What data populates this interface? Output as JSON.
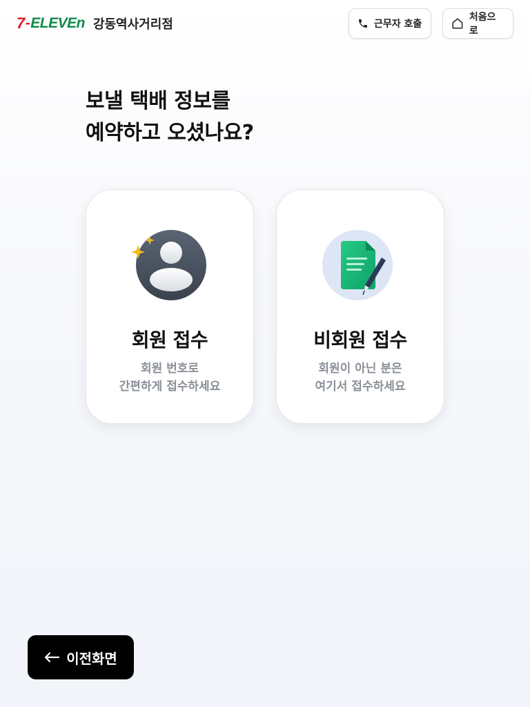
{
  "header": {
    "brand_seven": "7",
    "brand_eleven": "ELEVEn",
    "store_name": "강동역사거리점",
    "call_label": "근무자 호출",
    "home_label": "처음으로"
  },
  "main": {
    "question_line1": "보낼 택배 정보를",
    "question_line2": "예약하고 오셨나요?"
  },
  "options": [
    {
      "title": "회원 접수",
      "desc_line1": "회원 번호로",
      "desc_line2": "간편하게 접수하세요"
    },
    {
      "title": "비회원 접수",
      "desc_line1": "회원이 아닌 분은",
      "desc_line2": "여기서 접수하세요"
    }
  ],
  "footer": {
    "back_label": "이전화면"
  },
  "colors": {
    "brand_red": "#e31b23",
    "brand_green": "#0f8a4a",
    "primary_button": "#000000"
  },
  "icons": {
    "call": "phone-icon",
    "home": "home-icon",
    "member": "user-avatar-icon",
    "guest": "document-pen-icon",
    "back": "arrow-left-icon"
  }
}
